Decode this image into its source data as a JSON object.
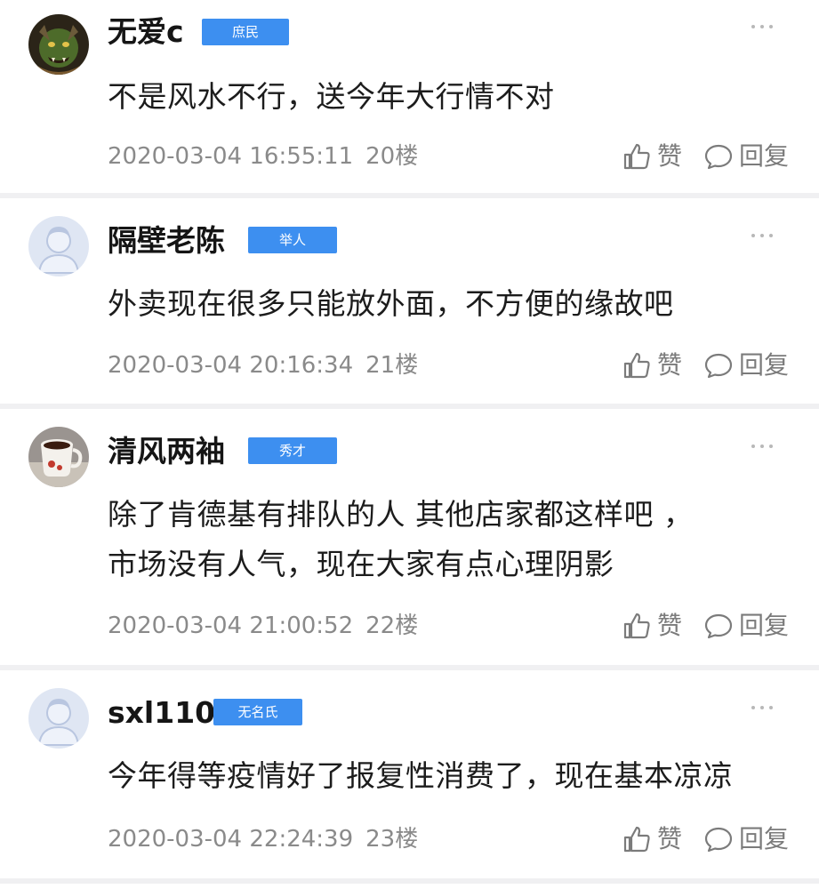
{
  "comments": [
    {
      "username": "无爱c",
      "badge": "庶民",
      "lines": [
        "不是风水不行，送今年大行情不对"
      ],
      "timestamp": "2020-03-04 16:55:11",
      "floor": "20楼",
      "like_label": "赞",
      "reply_label": "回复",
      "avatar": "orc-avatar"
    },
    {
      "username": "隔壁老陈",
      "badge": "举人",
      "lines": [
        "外卖现在很多只能放外面，不方便的缘故吧"
      ],
      "timestamp": "2020-03-04 20:16:34",
      "floor": "21楼",
      "like_label": "赞",
      "reply_label": "回复",
      "avatar": "default-avatar"
    },
    {
      "username": "清风两袖",
      "badge": "秀才",
      "lines": [
        "除了肯德基有排队的人  其他店家都这样吧 ，",
        "市场没有人气，现在大家有点心理阴影"
      ],
      "timestamp": "2020-03-04 21:00:52",
      "floor": "22楼",
      "like_label": "赞",
      "reply_label": "回复",
      "avatar": "coffee-cup-avatar"
    },
    {
      "username": "sxl110",
      "badge": "无名氏",
      "lines": [
        "今年得等疫情好了报复性消费了，现在基本凉凉"
      ],
      "timestamp": "2020-03-04 22:24:39",
      "floor": "23楼",
      "like_label": "赞",
      "reply_label": "回复",
      "avatar": "default-avatar"
    }
  ],
  "colors": {
    "badge": "#3d8ff0",
    "meta": "#8a8a8a",
    "divider": "#f0f0f2"
  }
}
